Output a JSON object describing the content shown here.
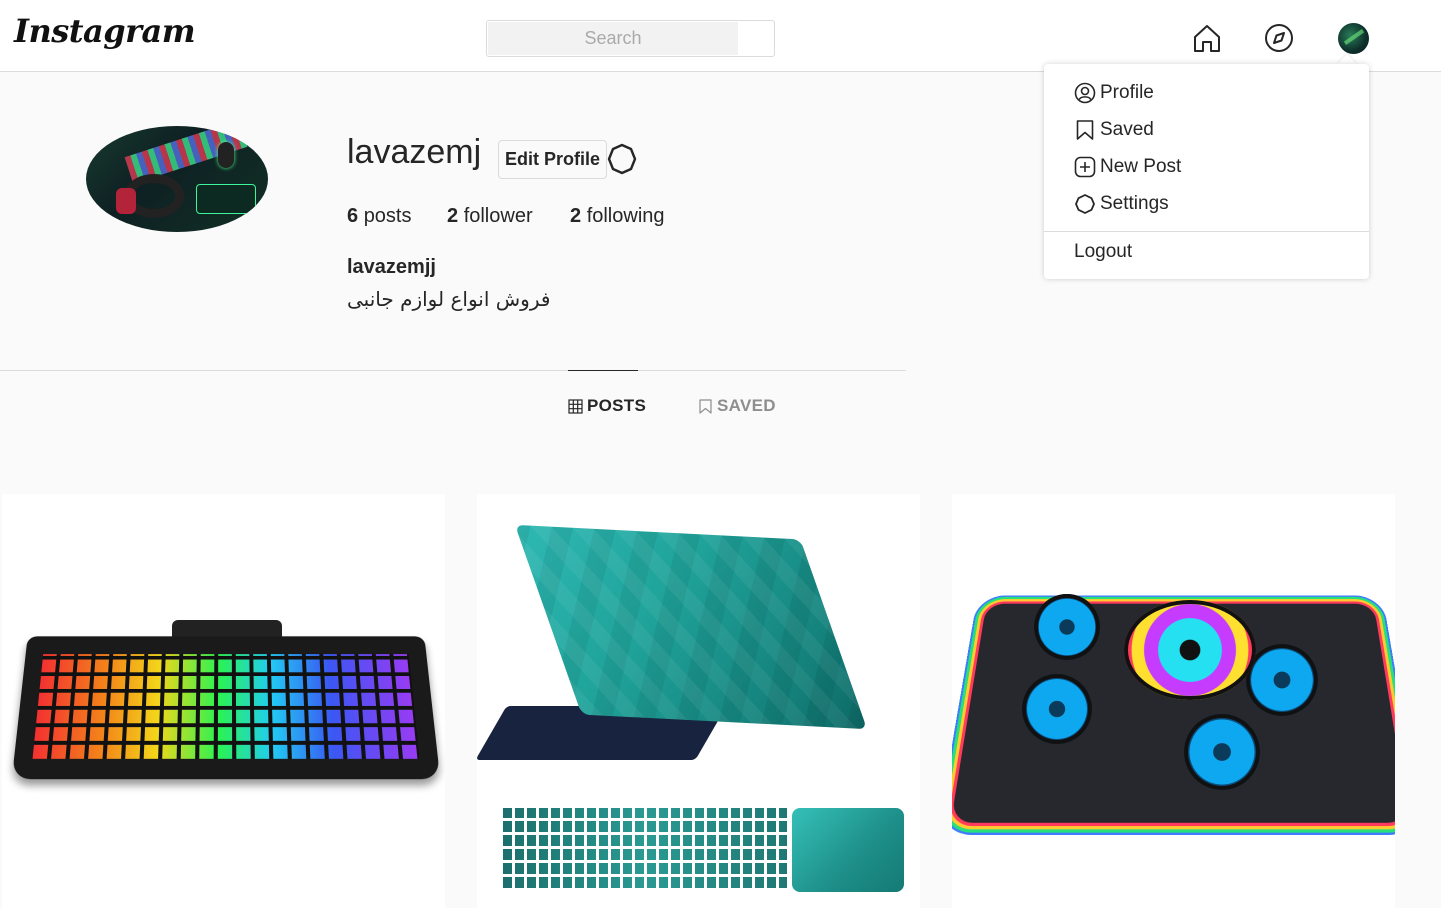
{
  "header": {
    "logo": "Instagram",
    "search_placeholder": "Search"
  },
  "dropdown": {
    "items": [
      {
        "label": "Profile",
        "icon": "user-circle-icon"
      },
      {
        "label": "Saved",
        "icon": "bookmark-icon"
      },
      {
        "label": "New Post",
        "icon": "plus-square-icon"
      },
      {
        "label": "Settings",
        "icon": "gear-icon"
      }
    ],
    "logout": "Logout"
  },
  "profile": {
    "username": "lavazemj",
    "edit_label": "Edit Profile",
    "posts_count": "6",
    "posts_label": "posts",
    "followers_count": "2",
    "followers_label": "follower",
    "following_count": "2",
    "following_label": "following",
    "full_name": "lavazemjj",
    "bio": "فروش انواع لوازم جانبی"
  },
  "tabs": {
    "posts": "POSTS",
    "saved": "SAVED"
  },
  "posts": [
    {
      "subject": "rgb-keyboard"
    },
    {
      "subject": "laptop-skin"
    },
    {
      "subject": "rgb-laptop-cooler"
    }
  ]
}
